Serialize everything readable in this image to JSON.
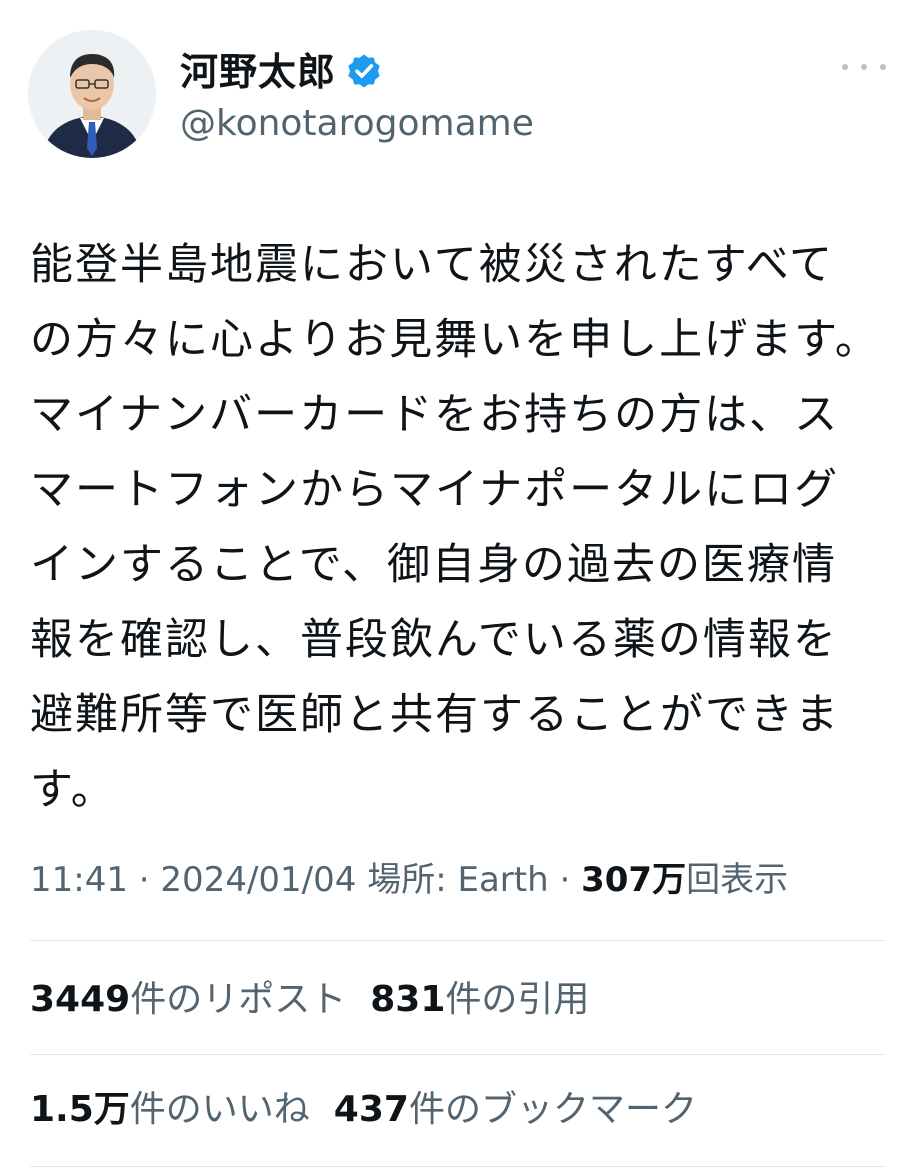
{
  "author": {
    "display_name": "河野太郎",
    "handle": "@konotarogomame",
    "verified_icon": "verified-badge-icon",
    "verified_color": "#1d9bf0"
  },
  "tweet": {
    "lines": [
      "能登半島地震において被災されたすべて",
      "の方々に心よりお見舞いを申し上げます。",
      "マイナンバーカードをお持ちの方は、ス",
      "マートフォンからマイナポータルにログ",
      "インすることで、御自身の過去の医療情",
      "報を確認し、普段飲んでいる薬の情報を",
      "避難所等で医師と共有することができま",
      "す。"
    ]
  },
  "meta": {
    "time": "11:41",
    "separator": " · ",
    "date": "2024/01/04",
    "location_prefix": " 場所: ",
    "location": "Earth",
    "views_count": "307万",
    "views_label": "回表示"
  },
  "stats": {
    "reposts_count": "3449",
    "reposts_label": "件のリポスト",
    "quotes_count": "831",
    "quotes_label": "件の引用",
    "likes_count": "1.5万",
    "likes_label": "件のいいね",
    "bookmarks_count": "437",
    "bookmarks_label": "件のブックマーク"
  },
  "colors": {
    "text_primary": "#0f1419",
    "text_secondary": "#536471",
    "divider": "#e3e7ea"
  }
}
